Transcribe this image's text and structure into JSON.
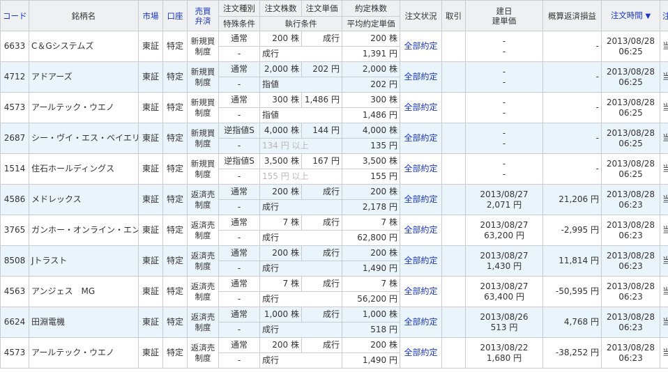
{
  "headers": {
    "code": "コード",
    "name": "銘柄名",
    "market": "市場",
    "account": "口座",
    "type_1": "売買",
    "type_2": "弁済",
    "kind": "注文種別",
    "special": "特殊条件",
    "qty": "注文株数",
    "exec_cond": "執行条件",
    "price": "注文単価",
    "done_qty": "約定株数",
    "avg_price": "平均約定単価",
    "status": "注文状況",
    "trade": "取引",
    "build_1": "建日",
    "build_2": "建単価",
    "pl": "概算返済損益",
    "time": "注文時間",
    "sort_mark": "▼",
    "limit": "注文期限"
  },
  "orders": [
    {
      "code": "6633",
      "name": "C＆Gシステムズ",
      "market": "東証",
      "account": "特定",
      "type1": "新規買",
      "type2": "制度",
      "kind": "通常",
      "special": "-",
      "qty": "200 株",
      "price": "成行",
      "cond": "成行",
      "cond_faded": false,
      "done_qty": "200 株",
      "avg_price": "1,391 円",
      "status": "全部約定",
      "trade": "",
      "build1": "-",
      "build2": "-",
      "pl": "-",
      "time1": "2013/08/28",
      "time2": "06:25",
      "limit": "当日限り"
    },
    {
      "code": "4712",
      "name": "アドアーズ",
      "market": "東証",
      "account": "特定",
      "type1": "新規買",
      "type2": "制度",
      "kind": "通常",
      "special": "-",
      "qty": "2,000 株",
      "price": "202 円",
      "cond": "指値",
      "cond_faded": false,
      "done_qty": "2,000 株",
      "avg_price": "202 円",
      "status": "全部約定",
      "trade": "",
      "build1": "-",
      "build2": "-",
      "pl": "-",
      "time1": "2013/08/28",
      "time2": "06:25",
      "limit": "当日限り"
    },
    {
      "code": "4573",
      "name": "アールテック・ウエノ",
      "market": "東証",
      "account": "特定",
      "type1": "新規買",
      "type2": "制度",
      "kind": "通常",
      "special": "-",
      "qty": "300 株",
      "price": "1,486 円",
      "cond": "指値",
      "cond_faded": false,
      "done_qty": "300 株",
      "avg_price": "1,486 円",
      "status": "全部約定",
      "trade": "",
      "build1": "-",
      "build2": "-",
      "pl": "-",
      "time1": "2013/08/28",
      "time2": "06:25",
      "limit": "当日限り"
    },
    {
      "code": "2687",
      "name": "シー・ヴイ・エス・ベイエリア",
      "market": "東証",
      "account": "特定",
      "type1": "新規買",
      "type2": "制度",
      "kind": "逆指値S",
      "special": "-",
      "qty": "4,000 株",
      "price": "144 円",
      "cond": "134 円 以上",
      "cond_faded": true,
      "done_qty": "4,000 株",
      "avg_price": "135 円",
      "status": "全部約定",
      "trade": "",
      "build1": "-",
      "build2": "-",
      "pl": "-",
      "time1": "2013/08/28",
      "time2": "06:25",
      "limit": "当日限り"
    },
    {
      "code": "1514",
      "name": "住石ホールディングス",
      "market": "東証",
      "account": "特定",
      "type1": "新規買",
      "type2": "制度",
      "kind": "逆指値S",
      "special": "-",
      "qty": "3,500 株",
      "price": "167 円",
      "cond": "155 円 以上",
      "cond_faded": true,
      "done_qty": "3,500 株",
      "avg_price": "155 円",
      "status": "全部約定",
      "trade": "",
      "build1": "-",
      "build2": "-",
      "pl": "-",
      "time1": "2013/08/28",
      "time2": "06:25",
      "limit": "当日限り"
    },
    {
      "code": "4586",
      "name": "メドレックス",
      "market": "東証",
      "account": "特定",
      "type1": "返済売",
      "type2": "制度",
      "kind": "通常",
      "special": "-",
      "qty": "200 株",
      "price": "成行",
      "cond": "成行",
      "cond_faded": false,
      "done_qty": "200 株",
      "avg_price": "2,178 円",
      "status": "全部約定",
      "trade": "",
      "build1": "2013/08/27",
      "build2": "2,071 円",
      "pl": "21,206 円",
      "time1": "2013/08/28",
      "time2": "06:23",
      "limit": "当日限り"
    },
    {
      "code": "3765",
      "name": "ガンホー・オンライン・エンター",
      "market": "東証",
      "account": "特定",
      "type1": "返済売",
      "type2": "制度",
      "kind": "通常",
      "special": "-",
      "qty": "7 株",
      "price": "成行",
      "cond": "成行",
      "cond_faded": false,
      "done_qty": "7 株",
      "avg_price": "62,800 円",
      "status": "全部約定",
      "trade": "",
      "build1": "2013/08/27",
      "build2": "63,200 円",
      "pl": "-2,995 円",
      "time1": "2013/08/28",
      "time2": "06:23",
      "limit": "当日限り"
    },
    {
      "code": "8508",
      "name": "Jトラスト",
      "market": "東証",
      "account": "特定",
      "type1": "返済売",
      "type2": "制度",
      "kind": "通常",
      "special": "-",
      "qty": "200 株",
      "price": "成行",
      "cond": "成行",
      "cond_faded": false,
      "done_qty": "200 株",
      "avg_price": "1,490 円",
      "status": "全部約定",
      "trade": "",
      "build1": "2013/08/27",
      "build2": "1,430 円",
      "pl": "11,814 円",
      "time1": "2013/08/28",
      "time2": "06:23",
      "limit": "当日限り"
    },
    {
      "code": "4563",
      "name": "アンジェス　MG",
      "market": "東証",
      "account": "特定",
      "type1": "返済売",
      "type2": "制度",
      "kind": "通常",
      "special": "-",
      "qty": "7 株",
      "price": "成行",
      "cond": "成行",
      "cond_faded": false,
      "done_qty": "7 株",
      "avg_price": "56,200 円",
      "status": "全部約定",
      "trade": "",
      "build1": "2013/08/27",
      "build2": "63,400 円",
      "pl": "-50,595 円",
      "time1": "2013/08/28",
      "time2": "06:23",
      "limit": "当日限り"
    },
    {
      "code": "6624",
      "name": "田淵電機",
      "market": "東証",
      "account": "特定",
      "type1": "返済売",
      "type2": "制度",
      "kind": "通常",
      "special": "-",
      "qty": "1,000 株",
      "price": "成行",
      "cond": "成行",
      "cond_faded": false,
      "done_qty": "1,000 株",
      "avg_price": "518 円",
      "status": "全部約定",
      "trade": "",
      "build1": "2013/08/26",
      "build2": "513 円",
      "pl": "4,768 円",
      "time1": "2013/08/28",
      "time2": "06:23",
      "limit": "当日限り"
    },
    {
      "code": "4573",
      "name": "アールテック・ウエノ",
      "market": "東証",
      "account": "特定",
      "type1": "返済売",
      "type2": "制度",
      "kind": "通常",
      "special": "-",
      "qty": "200 株",
      "price": "成行",
      "cond": "成行",
      "cond_faded": false,
      "done_qty": "200 株",
      "avg_price": "1,490 円",
      "status": "全部約定",
      "trade": "",
      "build1": "2013/08/22",
      "build2": "1,680 円",
      "pl": "-38,252 円",
      "time1": "2013/08/28",
      "time2": "06:23",
      "limit": "当日限り"
    }
  ]
}
